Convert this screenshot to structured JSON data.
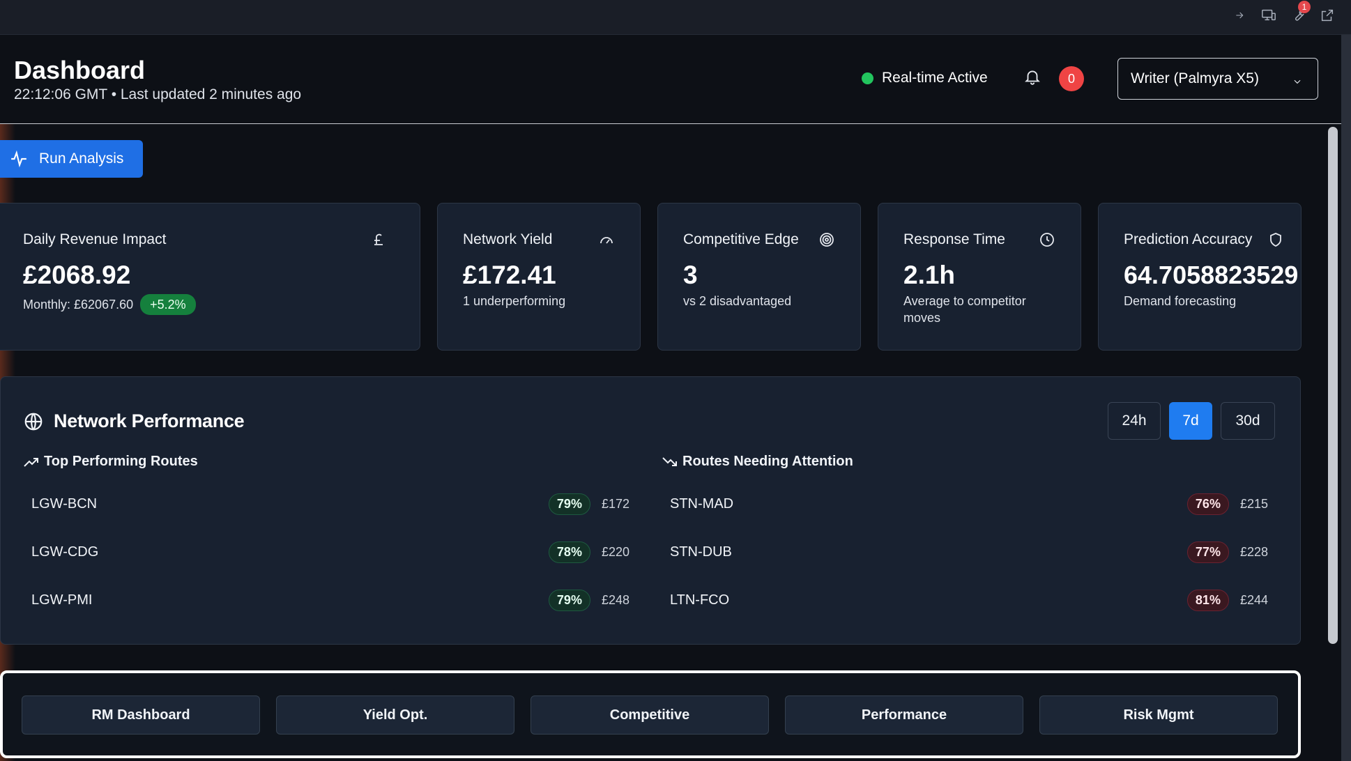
{
  "browser_tools": {
    "badge_count": "1"
  },
  "header": {
    "title": "Dashboard",
    "subtitle": "22:12:06 GMT • Last updated 2 minutes ago",
    "live_label": "Real-time Active",
    "notification_count": "0",
    "selector_value": "Writer (Palmyra X5)"
  },
  "actions": {
    "run_label": "Run Analysis"
  },
  "cards": [
    {
      "label": "Daily Revenue Impact",
      "icon": "pound-icon",
      "value": "£2068.92",
      "sub": "Monthly: £62067.60",
      "badge": "+5.2%"
    },
    {
      "label": "Network Yield",
      "icon": "gauge-icon",
      "value": "£172.41",
      "sub": "1 underperforming"
    },
    {
      "label": "Competitive Edge",
      "icon": "target-icon",
      "value": "3",
      "sub": "vs 2 disadvantaged"
    },
    {
      "label": "Response Time",
      "icon": "clock-icon",
      "value": "2.1h",
      "sub": "Average to competitor moves"
    },
    {
      "label": "Prediction Accuracy",
      "icon": "shield-icon",
      "value": "64.7058823529",
      "sub": "Demand forecasting"
    }
  ],
  "network": {
    "title": "Network Performance",
    "ranges": [
      "24h",
      "7d",
      "30d"
    ],
    "active_range": "7d",
    "top_heading": "Top Performing Routes",
    "attention_heading": "Routes Needing Attention",
    "top_routes": [
      {
        "route": "LGW-BCN",
        "pct": "79%",
        "price": "£172"
      },
      {
        "route": "LGW-CDG",
        "pct": "78%",
        "price": "£220"
      },
      {
        "route": "LGW-PMI",
        "pct": "79%",
        "price": "£248"
      }
    ],
    "attention_routes": [
      {
        "route": "STN-MAD",
        "pct": "76%",
        "price": "£215"
      },
      {
        "route": "STN-DUB",
        "pct": "77%",
        "price": "£228"
      },
      {
        "route": "LTN-FCO",
        "pct": "81%",
        "price": "£244"
      }
    ]
  },
  "nav": [
    "RM Dashboard",
    "Yield Opt.",
    "Competitive",
    "Performance",
    "Risk Mgmt"
  ],
  "colors": {
    "accent": "#1f7cf0",
    "live": "#22c55e",
    "alert": "#ef4444",
    "good": "#15803d"
  }
}
